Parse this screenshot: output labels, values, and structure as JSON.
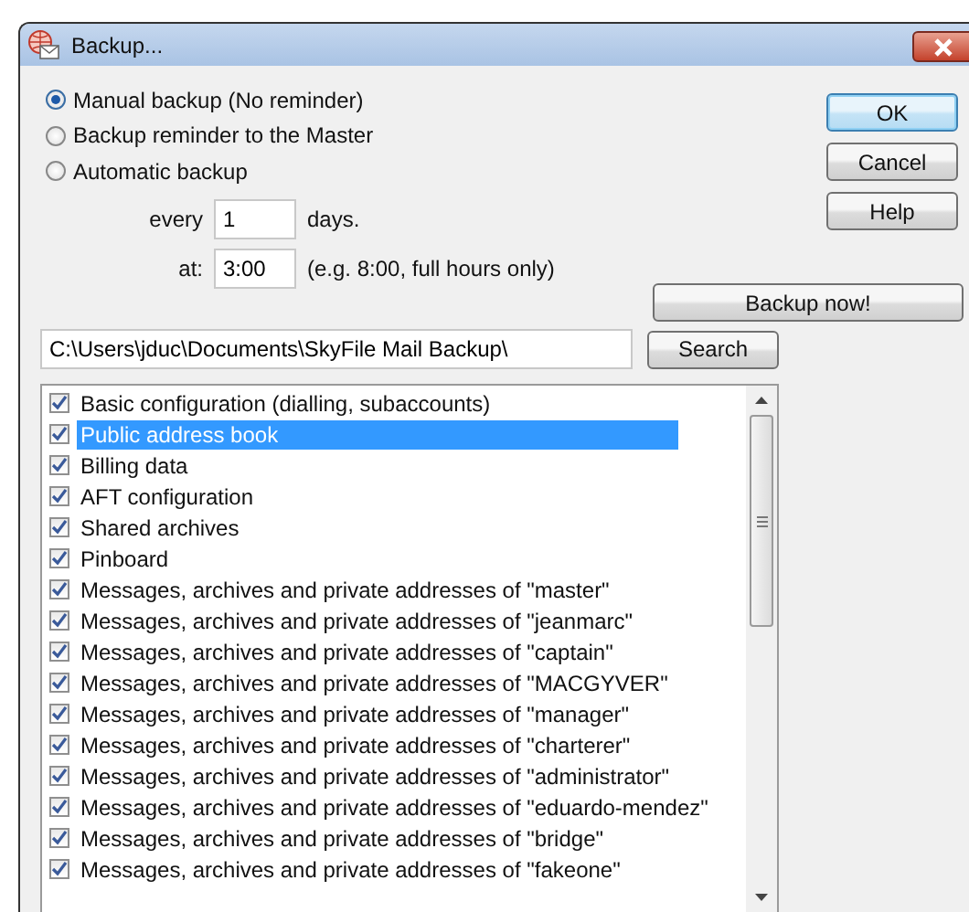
{
  "window": {
    "title": "Backup..."
  },
  "schedule_options": [
    {
      "label": "Manual backup (No reminder)",
      "selected": true
    },
    {
      "label": "Backup reminder to the Master",
      "selected": false
    },
    {
      "label": "Automatic backup",
      "selected": false
    }
  ],
  "interval": {
    "label": "every",
    "value": "1",
    "unit": "days."
  },
  "time": {
    "label": "at:",
    "value": "3:00",
    "hint": "(e.g. 8:00, full hours only)"
  },
  "buttons": [
    "OK",
    "Cancel",
    "Help"
  ],
  "backup_now_button": "Backup now!",
  "path": {
    "value": "C:\\Users\\jduc\\Documents\\SkyFile Mail Backup\\"
  },
  "search_button": "Search",
  "items": [
    {
      "label": "Basic configuration (dialling, subaccounts)",
      "checked": true,
      "selected": false
    },
    {
      "label": "Public address book",
      "checked": true,
      "selected": true
    },
    {
      "label": "Billing data",
      "checked": true,
      "selected": false
    },
    {
      "label": "AFT configuration",
      "checked": true,
      "selected": false
    },
    {
      "label": "Shared archives",
      "checked": true,
      "selected": false
    },
    {
      "label": "Pinboard",
      "checked": true,
      "selected": false
    },
    {
      "label": "Messages, archives and private addresses of \"master\"",
      "checked": true,
      "selected": false
    },
    {
      "label": "Messages, archives and private addresses of \"jeanmarc\"",
      "checked": true,
      "selected": false
    },
    {
      "label": "Messages, archives and private addresses of \"captain\"",
      "checked": true,
      "selected": false
    },
    {
      "label": "Messages, archives and private addresses of \"MACGYVER\"",
      "checked": true,
      "selected": false
    },
    {
      "label": "Messages, archives and private addresses of \"manager\"",
      "checked": true,
      "selected": false
    },
    {
      "label": "Messages, archives and private addresses of \"charterer\"",
      "checked": true,
      "selected": false
    },
    {
      "label": "Messages, archives and private addresses of \"administrator\"",
      "checked": true,
      "selected": false
    },
    {
      "label": "Messages, archives and private addresses of \"eduardo-mendez\"",
      "checked": true,
      "selected": false
    },
    {
      "label": "Messages, archives and private addresses of \"bridge\"",
      "checked": true,
      "selected": false
    },
    {
      "label": "Messages, archives and private addresses of \"fakeone\"",
      "checked": true,
      "selected": false
    }
  ]
}
